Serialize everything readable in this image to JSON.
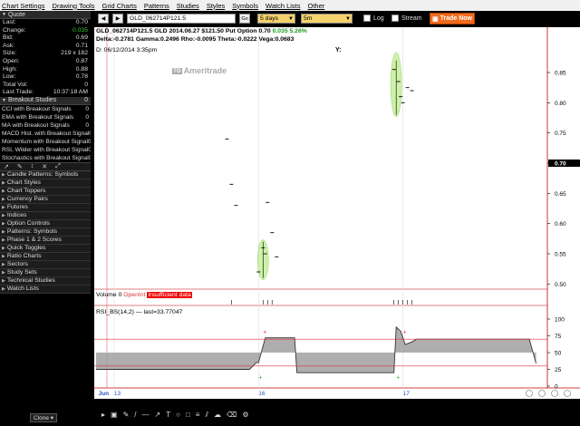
{
  "menu": [
    "Chart Settings",
    "Drawing Tools",
    "Grid Charts",
    "Patterns",
    "Studies",
    "Styles",
    "Symbols",
    "Watch Lists",
    "Other"
  ],
  "quote": {
    "header": "Quote",
    "rows": [
      {
        "label": "Last:",
        "value": "0.70"
      },
      {
        "label": "Change:",
        "value": "0.035"
      },
      {
        "label": "Bid:",
        "value": "0.69"
      },
      {
        "label": "Ask:",
        "value": "0.71"
      },
      {
        "label": "Size:",
        "value": "219 x 182"
      },
      {
        "label": "Open:",
        "value": "0.87"
      },
      {
        "label": "High:",
        "value": "0.88"
      },
      {
        "label": "Low:",
        "value": "0.78"
      },
      {
        "label": "Total Vol:",
        "value": "0"
      },
      {
        "label": "Last Trade:",
        "value": "10:37:18 AM"
      }
    ]
  },
  "breakout": {
    "header": "Breakout Studies",
    "count": "0",
    "items": [
      {
        "name": "CCI with Breakout Signals",
        "count": "0"
      },
      {
        "name": "EMA with Breakout Signals",
        "count": "0"
      },
      {
        "name": "MA with Breakout Signals",
        "count": "0"
      },
      {
        "name": "MACD Hist. with Breakout Signal",
        "count": "0"
      },
      {
        "name": "Momentum with Breakout Signal",
        "count": "0"
      },
      {
        "name": "RSI, Wilder with Breakout Signal",
        "count": "0"
      },
      {
        "name": "Stochastics with Breakout Signal",
        "count": "0"
      }
    ]
  },
  "lists": [
    "Candle Patterns: Symbols",
    "Chart Styles",
    "Chart Toppers",
    "Currency Pairs",
    "Futures",
    "Indices",
    "Option Controls",
    "Patterns: Symbols",
    "Phase 1 & 2 Scores",
    "Quick Toggles",
    "Ratio Charts",
    "Sectors",
    "Study Sets",
    "Technical Studies",
    "Watch Lists"
  ],
  "clone_label": "Clone",
  "toolbar": {
    "symbol": "GLD_062714P121.5",
    "go": "Go",
    "period": "5 days",
    "interval": "5m",
    "log_label": "Log",
    "stream_label": "Stream",
    "trade_now": "Trade Now"
  },
  "chart": {
    "header_line1": "GLD_062714P121.5 GLD 2014.06.27 $121.50 Put Option",
    "header_last": "0.70",
    "header_change": "0.035",
    "header_pct": "5.26%",
    "header_line2": "Delta:-0.2781  Gamma:0.2496  Rho:-0.0095  Theta:-0.0222  Vega:0.0683",
    "date_line": "D: 06/12/2014    3:35pm",
    "y_label": "Y:",
    "watermark_logo": "TD",
    "watermark_text": "Ameritrade",
    "volume_label": "Volume",
    "volume_value": "0",
    "open_int_label": "OpenInt",
    "insufficient": "Insufficient data",
    "rsi_label": "RSI_BS(14,2) — last=33.77047",
    "current_price_tag": "0.70",
    "colors": {
      "background": "#ffffff",
      "rsi_fill": "#a0a0a0",
      "rsi_line": "#333333",
      "overbought": "#e03030",
      "highlight": "#c8f0a0",
      "trade_button": "#f06a1e",
      "axis_red": "#c00000"
    }
  },
  "chart_data": {
    "type": "line",
    "price_axis": {
      "ticks": [
        "0.85",
        "0.80",
        "0.75",
        "0.70",
        "0.65",
        "0.60",
        "0.55",
        "0.50"
      ],
      "ylim": [
        0.49,
        0.88
      ]
    },
    "rsi_axis": {
      "ticks": [
        "100",
        "75",
        "50",
        "25",
        "0"
      ],
      "ylim": [
        0,
        100
      ],
      "overbought": 70,
      "oversold": 30
    },
    "x_ticks": [
      "Jun",
      "13",
      "16",
      "17"
    ],
    "price_points": [
      {
        "x": 0.29,
        "y": 0.74
      },
      {
        "x": 0.3,
        "y": 0.665
      },
      {
        "x": 0.31,
        "y": 0.63
      },
      {
        "x": 0.36,
        "y": 0.52
      },
      {
        "x": 0.37,
        "y": 0.56
      },
      {
        "x": 0.375,
        "y": 0.55
      },
      {
        "x": 0.38,
        "y": 0.635
      },
      {
        "x": 0.39,
        "y": 0.585
      },
      {
        "x": 0.4,
        "y": 0.545
      },
      {
        "x": 0.66,
        "y": 0.855
      },
      {
        "x": 0.67,
        "y": 0.835
      },
      {
        "x": 0.675,
        "y": 0.81
      },
      {
        "x": 0.68,
        "y": 0.8
      },
      {
        "x": 0.69,
        "y": 0.825
      },
      {
        "x": 0.7,
        "y": 0.82
      }
    ],
    "highlight_ovals": [
      {
        "x": 0.37,
        "y_low": 0.51,
        "y_high": 0.57
      },
      {
        "x": 0.665,
        "y_low": 0.78,
        "y_high": 0.88
      }
    ],
    "rsi_series": [
      {
        "x": 0.0,
        "y": 25
      },
      {
        "x": 0.34,
        "y": 25
      },
      {
        "x": 0.355,
        "y": 35
      },
      {
        "x": 0.36,
        "y": 35
      },
      {
        "x": 0.375,
        "y": 72
      },
      {
        "x": 0.44,
        "y": 72
      },
      {
        "x": 0.445,
        "y": 20
      },
      {
        "x": 0.66,
        "y": 20
      },
      {
        "x": 0.665,
        "y": 88
      },
      {
        "x": 0.675,
        "y": 82
      },
      {
        "x": 0.685,
        "y": 62
      },
      {
        "x": 0.7,
        "y": 66
      },
      {
        "x": 0.71,
        "y": 70
      },
      {
        "x": 0.96,
        "y": 70
      },
      {
        "x": 0.975,
        "y": 33.77
      }
    ]
  }
}
